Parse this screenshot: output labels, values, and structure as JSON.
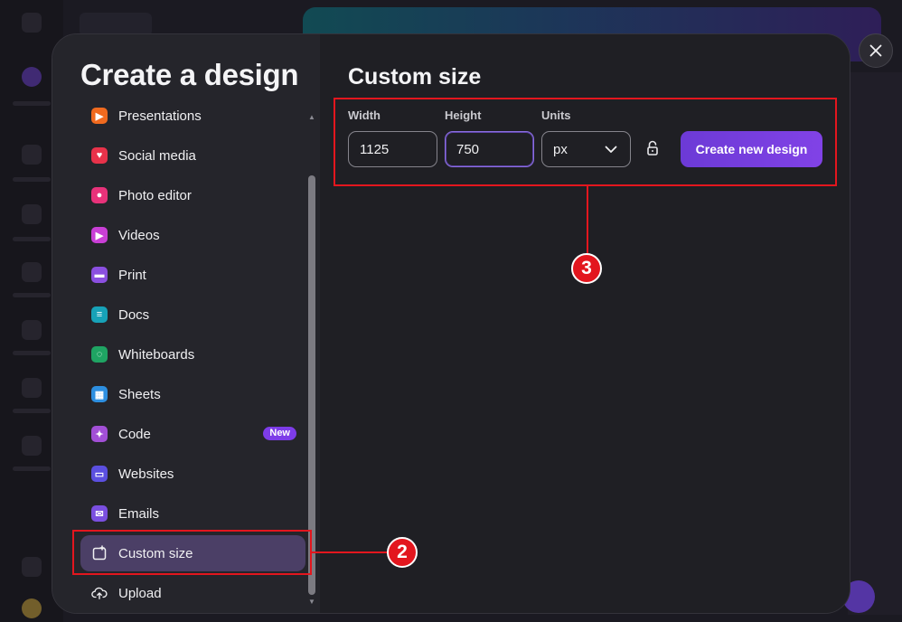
{
  "modal": {
    "title": "Create a design",
    "nav_items": [
      {
        "label": "Presentations",
        "icon": "presentation-icon",
        "color": "#f06a1f"
      },
      {
        "label": "Social media",
        "icon": "heart-icon",
        "color": "#e8324a"
      },
      {
        "label": "Photo editor",
        "icon": "camera-icon",
        "color": "#e8327a"
      },
      {
        "label": "Videos",
        "icon": "video-icon",
        "color": "#c93fd6"
      },
      {
        "label": "Print",
        "icon": "printer-icon",
        "color": "#8b4fe0"
      },
      {
        "label": "Docs",
        "icon": "document-icon",
        "color": "#17a2b8"
      },
      {
        "label": "Whiteboards",
        "icon": "whiteboard-icon",
        "color": "#1fa463"
      },
      {
        "label": "Sheets",
        "icon": "sheets-icon",
        "color": "#2d8fe0"
      },
      {
        "label": "Code",
        "icon": "code-icon",
        "color": "#a24fd6",
        "badge": "New"
      },
      {
        "label": "Websites",
        "icon": "website-icon",
        "color": "#5b4fe0"
      },
      {
        "label": "Emails",
        "icon": "email-icon",
        "color": "#7a4fe0"
      },
      {
        "label": "Custom size",
        "icon": "custom-size-icon",
        "color": "#ffffff",
        "active": true
      },
      {
        "label": "Upload",
        "icon": "upload-icon",
        "color": "#ffffff"
      }
    ],
    "custom_size": {
      "title": "Custom size",
      "width_label": "Width",
      "width_value": "1125",
      "height_label": "Height",
      "height_value": "750",
      "units_label": "Units",
      "units_value": "px",
      "create_button": "Create new design"
    }
  },
  "annotations": {
    "marker_custom_size": "2",
    "marker_fields": "3",
    "color": "#e3161e"
  },
  "colors": {
    "accent": "#7d3ce8",
    "active_nav": "#4b3f66"
  }
}
